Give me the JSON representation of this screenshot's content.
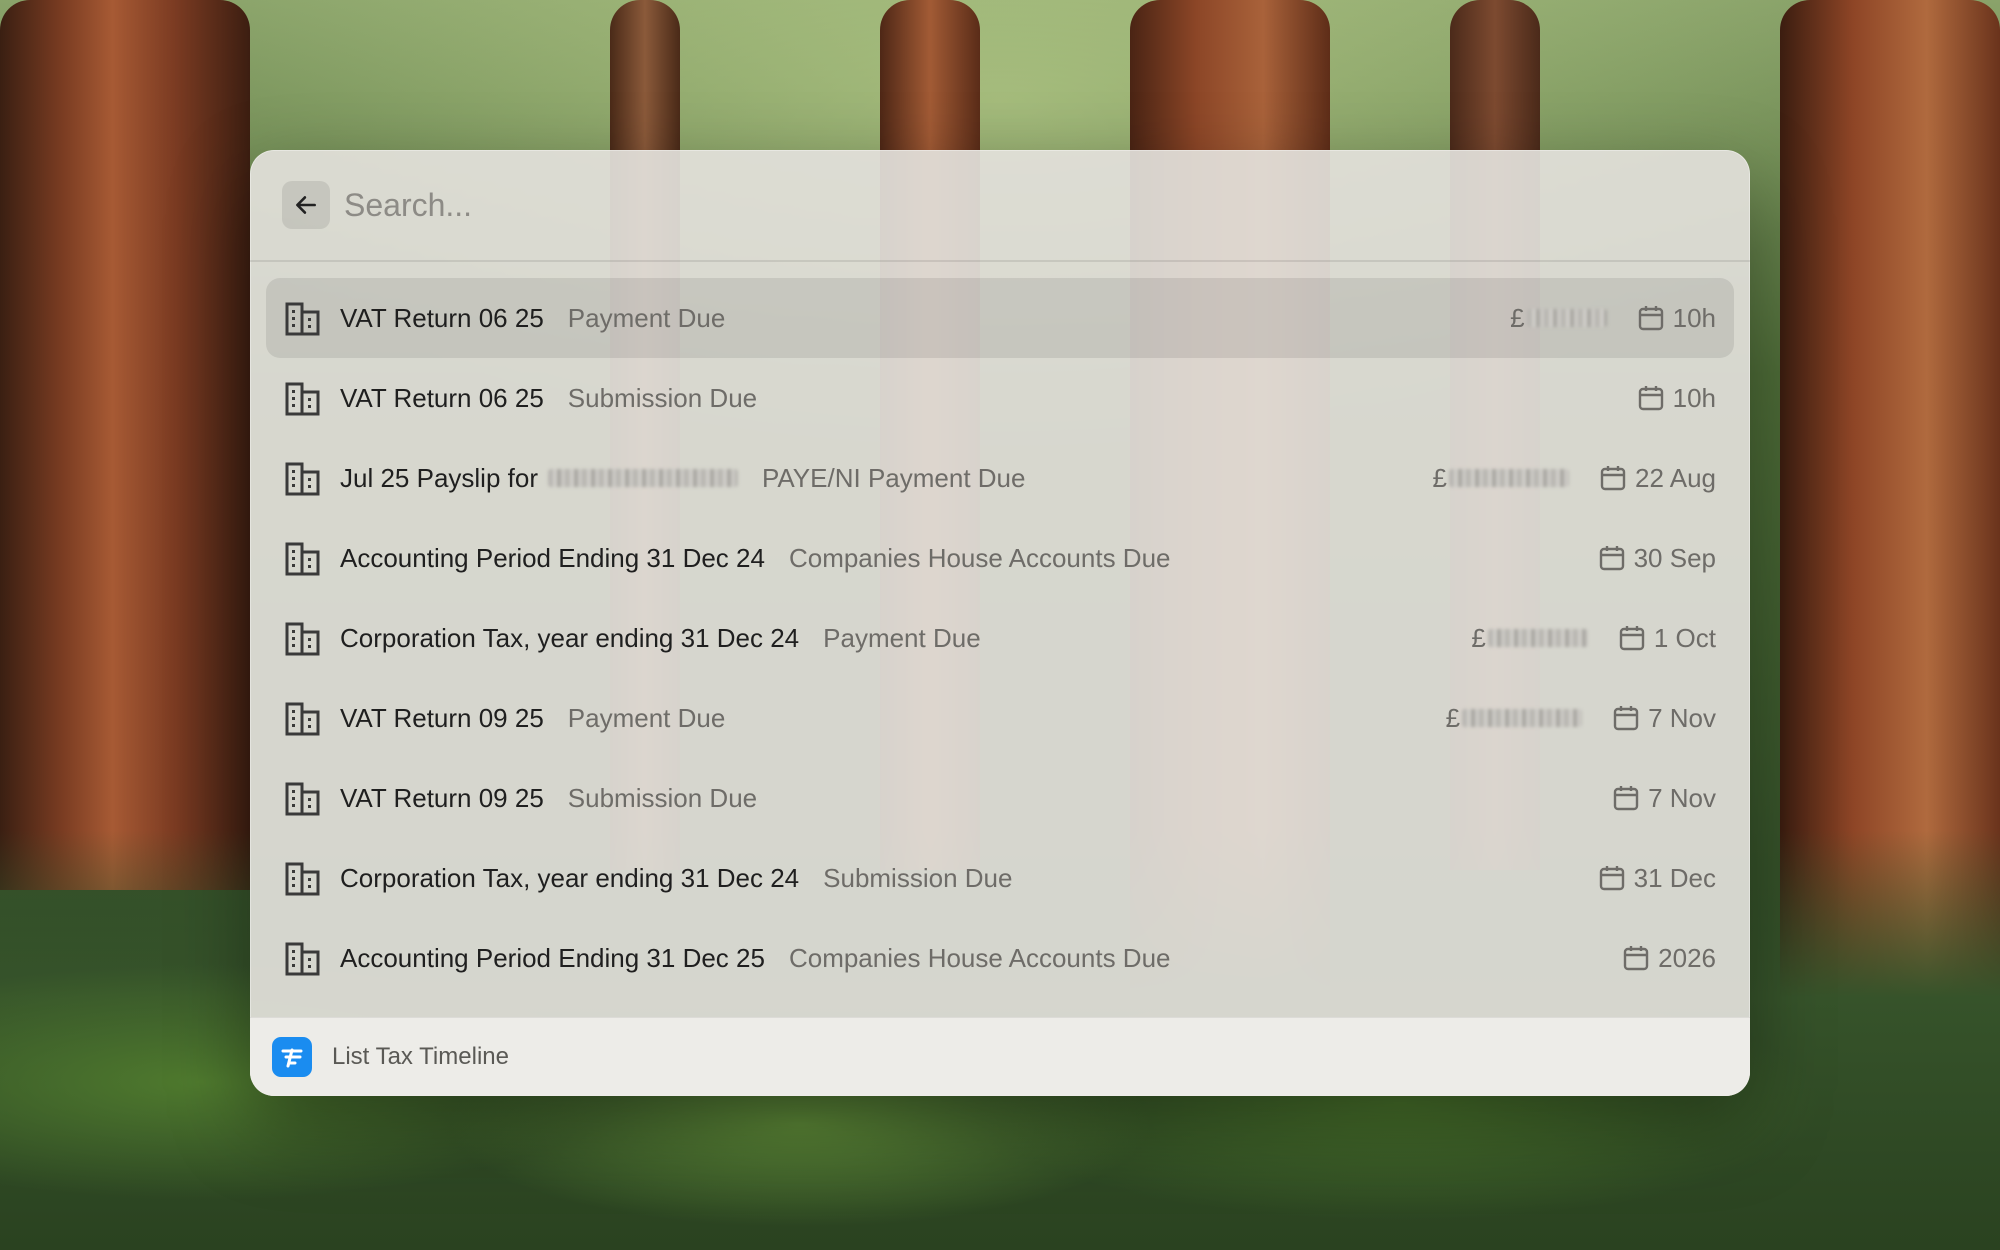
{
  "search": {
    "placeholder": "Search..."
  },
  "results": [
    {
      "title": "VAT Return 06 25",
      "subtitle": "Payment Due",
      "amount_prefix": "£",
      "amount_redacted": true,
      "date": "10h",
      "selected": true
    },
    {
      "title": "VAT Return 06 25",
      "subtitle": "Submission Due",
      "amount_redacted": false,
      "date": "10h",
      "selected": false
    },
    {
      "title": "Jul 25 Payslip for",
      "name_redacted": true,
      "subtitle": "PAYE/NI Payment Due",
      "amount_prefix": "£",
      "amount_redacted": true,
      "date": "22 Aug",
      "selected": false
    },
    {
      "title": "Accounting Period Ending 31 Dec 24",
      "subtitle": "Companies House Accounts Due",
      "amount_redacted": false,
      "date": "30 Sep",
      "selected": false
    },
    {
      "title": "Corporation Tax, year ending 31 Dec 24",
      "subtitle": "Payment Due",
      "amount_prefix": "£",
      "amount_redacted": true,
      "date": "1 Oct",
      "selected": false
    },
    {
      "title": "VAT Return 09 25",
      "subtitle": "Payment Due",
      "amount_prefix": "£",
      "amount_redacted": true,
      "date": "7 Nov",
      "selected": false
    },
    {
      "title": "VAT Return 09 25",
      "subtitle": "Submission Due",
      "amount_redacted": false,
      "date": "7 Nov",
      "selected": false
    },
    {
      "title": "Corporation Tax, year ending 31 Dec 24",
      "subtitle": "Submission Due",
      "amount_redacted": false,
      "date": "31 Dec",
      "selected": false
    },
    {
      "title": "Accounting Period Ending 31 Dec 25",
      "subtitle": "Companies House Accounts Due",
      "amount_redacted": false,
      "date": "2026",
      "selected": false
    }
  ],
  "footer": {
    "label": "List Tax Timeline",
    "app_icon": "freeagent-logo-icon",
    "app_color": "#1a8cf0"
  },
  "icons": {
    "row": "building-icon",
    "date": "calendar-icon",
    "back": "arrow-left-icon"
  }
}
